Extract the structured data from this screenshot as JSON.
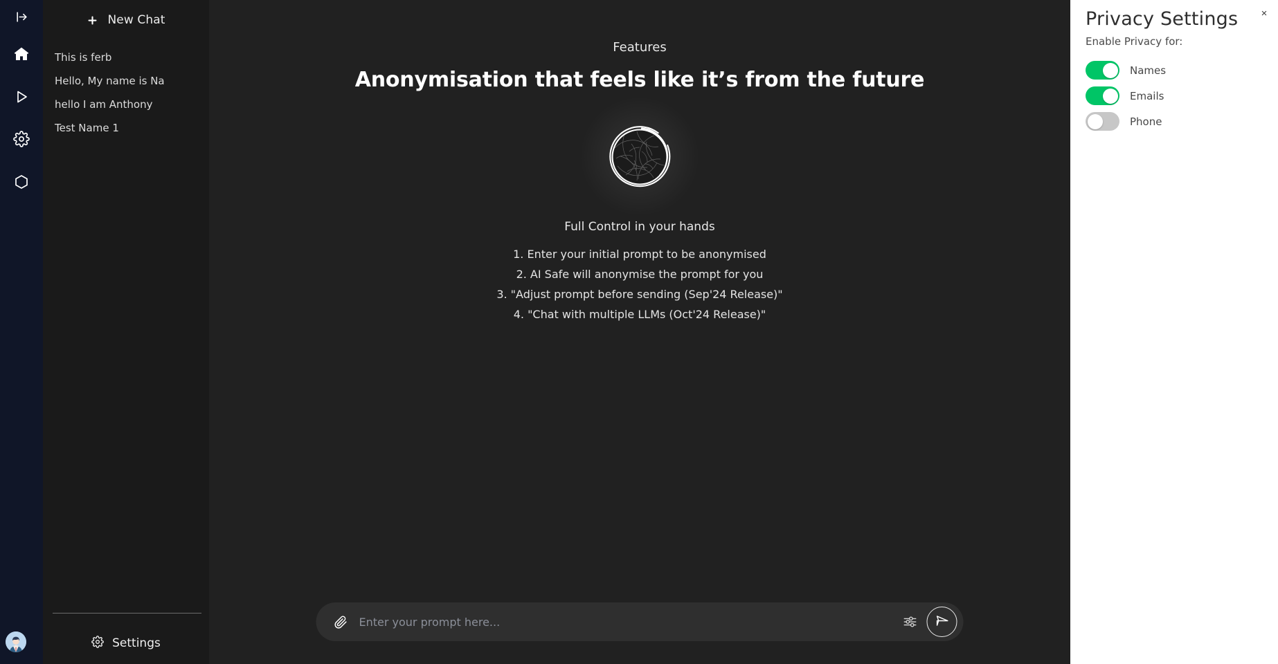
{
  "rail": {
    "icons": [
      {
        "name": "collapse-expand-icon",
        "label": "Expand sidebar"
      },
      {
        "name": "home-icon",
        "label": "Home"
      },
      {
        "name": "play-icon",
        "label": "Play"
      },
      {
        "name": "gear-icon",
        "label": "Settings"
      },
      {
        "name": "hexagon-icon",
        "label": "Models"
      }
    ],
    "avatar_label": "User avatar"
  },
  "sidebar": {
    "new_chat_label": "New Chat",
    "plus_icon": "plus-icon",
    "chats": [
      {
        "title": "This is ferb"
      },
      {
        "title": "Hello, My name is Na"
      },
      {
        "title": "hello I am Anthony"
      },
      {
        "title": "Test Name 1"
      }
    ],
    "settings_label": "Settings",
    "settings_icon": "gear-icon"
  },
  "main": {
    "eyebrow": "Features",
    "title": "Anonymisation that feels like it’s from the future",
    "logo_icon": "sketch-globe-icon",
    "steps_heading": "Full Control in your hands",
    "steps": [
      "1. Enter your initial prompt to be anonymised",
      "2. AI Safe will anonymise the prompt for you",
      "3. \"Adjust prompt before sending (Sep'24 Release)\"",
      "4. \"Chat with multiple LLMs (Oct'24 Release)\""
    ]
  },
  "prompt_bar": {
    "attach_icon": "paperclip-icon",
    "placeholder": "Enter your prompt here...",
    "value": "",
    "tune_icon": "sliders-icon",
    "send_icon": "send-icon"
  },
  "privacy": {
    "title": "Privacy Settings",
    "close_icon": "close-icon",
    "close_label": "×",
    "subtitle": "Enable Privacy for:",
    "toggles": [
      {
        "label": "Names",
        "on": true
      },
      {
        "label": "Emails",
        "on": true
      },
      {
        "label": "Phone",
        "on": false
      }
    ]
  },
  "colors": {
    "rail_bg": "#101628",
    "sidebar_bg": "#1a1a1a",
    "main_bg": "#212121",
    "panel_bg": "#ffffff",
    "toggle_on": "#00c566",
    "toggle_off": "#c7c7c7",
    "prompt_bg": "#2f2f2f"
  }
}
